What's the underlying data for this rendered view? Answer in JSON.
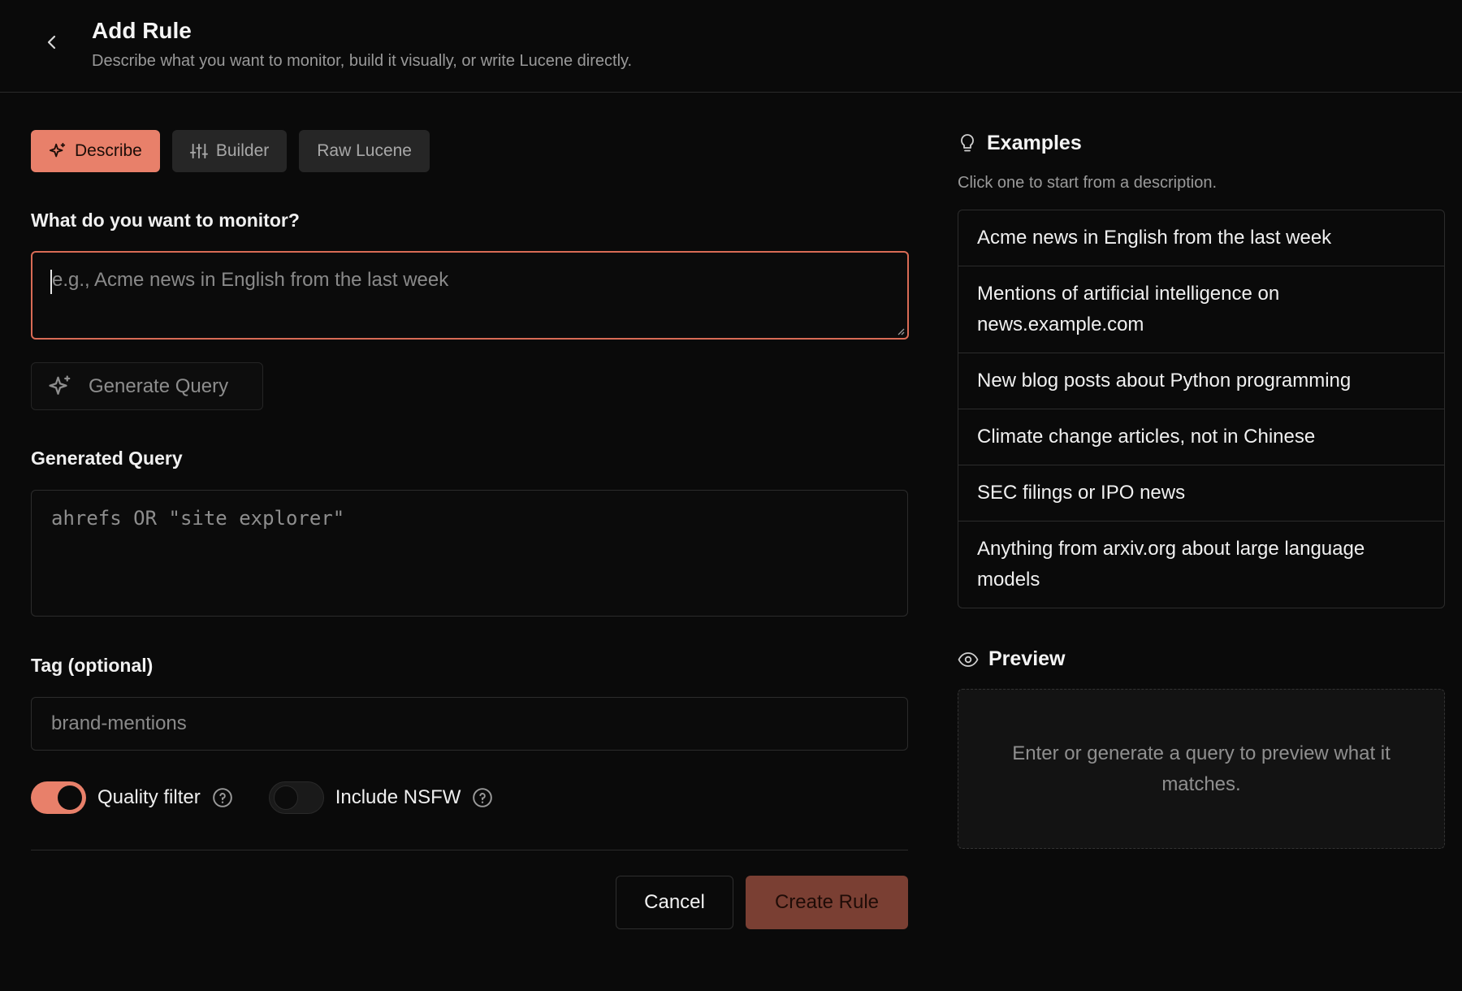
{
  "header": {
    "title": "Add Rule",
    "subtitle": "Describe what you want to monitor, build it visually, or write Lucene directly."
  },
  "tabs": [
    {
      "label": "Describe",
      "icon": "sparkle-icon",
      "active": true
    },
    {
      "label": "Builder",
      "icon": "sliders-icon",
      "active": false
    },
    {
      "label": "Raw Lucene",
      "active": false
    }
  ],
  "describe": {
    "label": "What do you want to monitor?",
    "placeholder": "e.g., Acme news in English from the last week",
    "generate_label": "Generate Query"
  },
  "generated_query": {
    "label": "Generated Query",
    "value": "ahrefs OR \"site explorer\""
  },
  "tag": {
    "label": "Tag (optional)",
    "placeholder": "brand-mentions"
  },
  "toggles": {
    "quality_label": "Quality filter",
    "quality_on": true,
    "nsfw_label": "Include NSFW",
    "nsfw_on": false
  },
  "actions": {
    "cancel_label": "Cancel",
    "create_label": "Create Rule"
  },
  "examples": {
    "title": "Examples",
    "subtitle": "Click one to start from a description.",
    "items": [
      "Acme news in English from the last week",
      "Mentions of artificial intelligence on news.example.com",
      "New blog posts about Python programming",
      "Climate change articles, not in Chinese",
      "SEC filings or IPO news",
      "Anything from arxiv.org about large language models"
    ]
  },
  "preview": {
    "title": "Preview",
    "empty_text": "Enter or generate a query to preview what it matches."
  },
  "colors": {
    "accent": "#e8806a",
    "accent_border": "#d96b55",
    "create_button": "#7a3f33",
    "background": "#0a0a0a"
  }
}
